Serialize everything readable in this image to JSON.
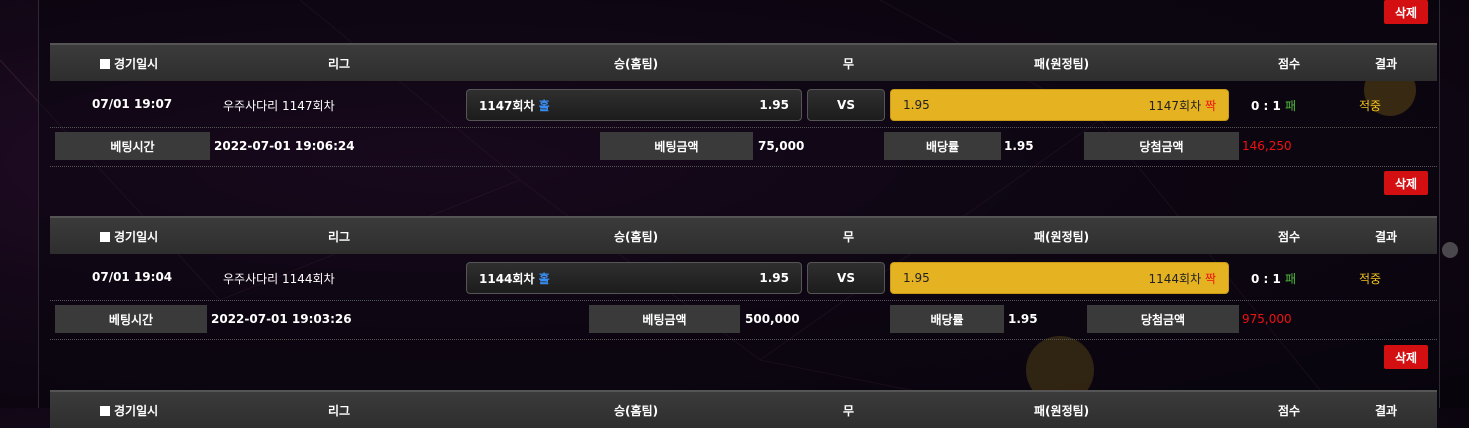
{
  "delete_label": "삭제",
  "headers": {
    "date": "경기일시",
    "league": "리그",
    "home": "승(홈팀)",
    "draw": "무",
    "away": "패(원정팀)",
    "score": "점수",
    "result": "결과"
  },
  "detail_labels": {
    "bet_time": "베팅시간",
    "bet_amount": "베팅금액",
    "odds": "배당률",
    "win_amount": "당첨금액"
  },
  "bets": [
    {
      "date": "07/01 19:07",
      "league": "우주사다리 1147회차",
      "home_name": "1147회차",
      "home_tag": "홀",
      "home_odds": "1.95",
      "vs": "VS",
      "away_odds": "1.95",
      "away_name": "1147회차",
      "away_tag": "짝",
      "score": "0 : 1",
      "score_tag": "패",
      "result": "적중",
      "bet_time": "2022-07-01 19:06:24",
      "bet_amount": "75,000",
      "odds": "1.95",
      "win_amount": "146,250"
    },
    {
      "date": "07/01 19:04",
      "league": "우주사다리 1144회차",
      "home_name": "1144회차",
      "home_tag": "홀",
      "home_odds": "1.95",
      "vs": "VS",
      "away_odds": "1.95",
      "away_name": "1144회차",
      "away_tag": "짝",
      "score": "0 : 1",
      "score_tag": "패",
      "result": "적중",
      "bet_time": "2022-07-01 19:03:26",
      "bet_amount": "500,000",
      "odds": "1.95",
      "win_amount": "975,000"
    }
  ]
}
